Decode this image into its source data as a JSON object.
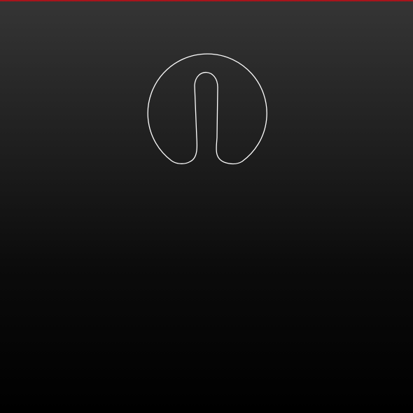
{
  "colors": {
    "accent_bar": "#a8141b",
    "logo_stroke": "#ffffff",
    "background_top": "#353535",
    "background_bottom": "#000000"
  },
  "logo": {
    "icon": "power-standby-icon"
  }
}
